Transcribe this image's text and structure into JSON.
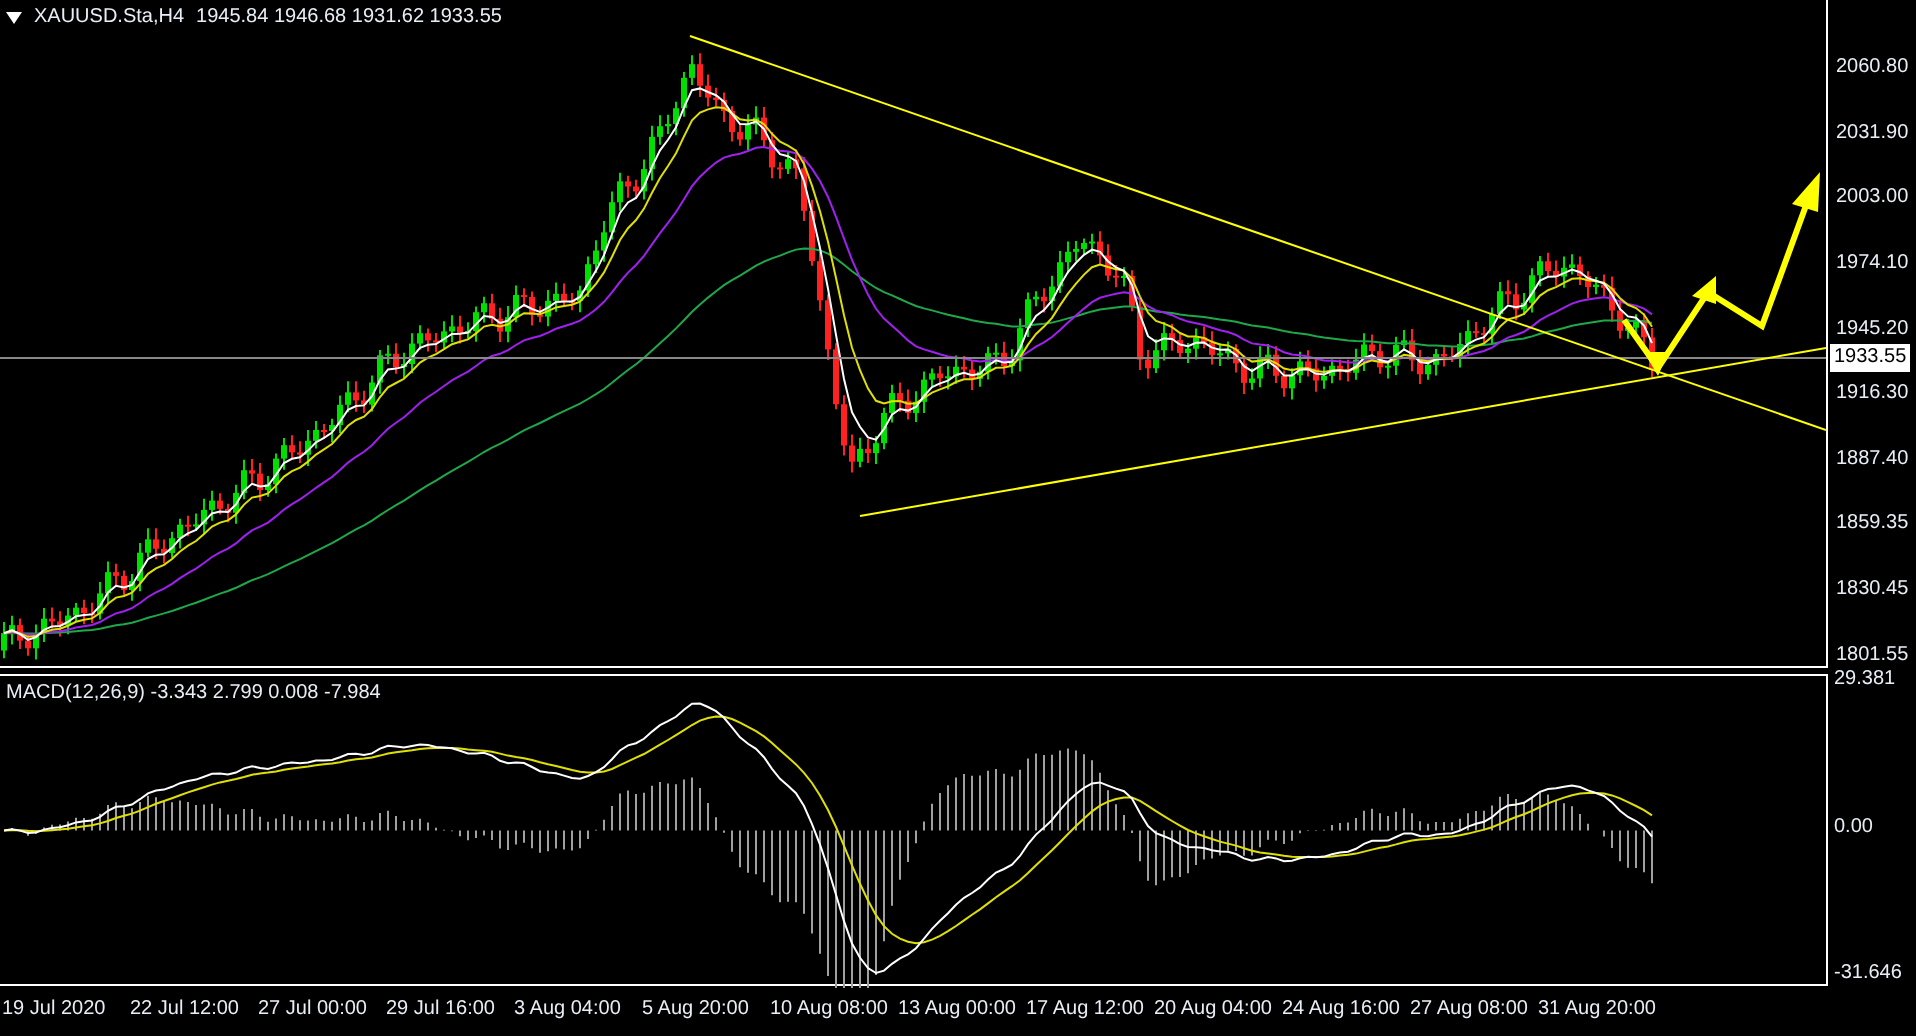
{
  "chart_header": {
    "symbol": "XAUUSD.Sta,H4",
    "ohlc": "1945.84 1946.68 1931.62 1933.55"
  },
  "price_axis": {
    "ticks": [
      "2060.80",
      "2031.90",
      "2003.00",
      "1974.10",
      "1945.20",
      "1916.30",
      "1887.40",
      "1859.35",
      "1830.45",
      "1801.55"
    ],
    "current_price": "1933.55"
  },
  "macd_panel": {
    "label": "MACD(12,26,9) -3.343 2.799 0.008 -7.984",
    "ticks": [
      "29.381",
      "0.00",
      "-31.646"
    ]
  },
  "time_axis": [
    "19 Jul 2020",
    "22 Jul 12:00",
    "27 Jul 00:00",
    "29 Jul 16:00",
    "3 Aug 04:00",
    "5 Aug 20:00",
    "10 Aug 08:00",
    "13 Aug 00:00",
    "17 Aug 12:00",
    "20 Aug 04:00",
    "24 Aug 16:00",
    "27 Aug 08:00",
    "31 Aug 20:00"
  ]
}
